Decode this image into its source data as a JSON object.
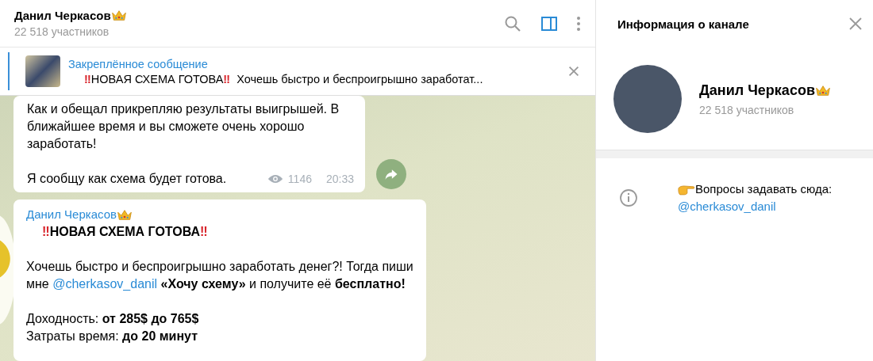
{
  "header": {
    "title": "Данил Черкасов",
    "subtitle": "22 518 участников",
    "panel_toggle_on": true
  },
  "pinned": {
    "label": "Закреплённое сообщение",
    "lead": "‼",
    "headline": "НОВАЯ СХЕМА ГОТОВА",
    "trail": "‼",
    "rest": "Хочешь быстро и беспроигрышно заработат..."
  },
  "messages": [
    {
      "kind": "text",
      "lines": [
        "Как и обещал прикрепляю результаты выигрышей. В ближайшее время и вы сможете очень хорошо заработать!",
        "Я сообщу как схема будет готова."
      ],
      "views": "1146",
      "time": "20:33"
    },
    {
      "kind": "post",
      "author": "Данил Черкасов",
      "lead": "‼",
      "headline": "НОВАЯ СХЕМА ГОТОВА",
      "trail": "‼",
      "before": "Хочешь быстро и беспроигрышно заработать денег?! Тогда пиши мне",
      "link": "@cherkasov_danil",
      "after": "**«Хочу схему»** и получите её **бесплатно!**",
      "stats": [
        "Доходность: **от 285$ до 765$**",
        "Затраты время: **до 20 минут**"
      ]
    }
  ],
  "info_panel": {
    "title": "Информация о канале",
    "name": "Данил Черкасов",
    "subtitle": "22 518 участников",
    "description": "Вопросы задавать сюда:",
    "link": "@cherkasov_danil"
  }
}
